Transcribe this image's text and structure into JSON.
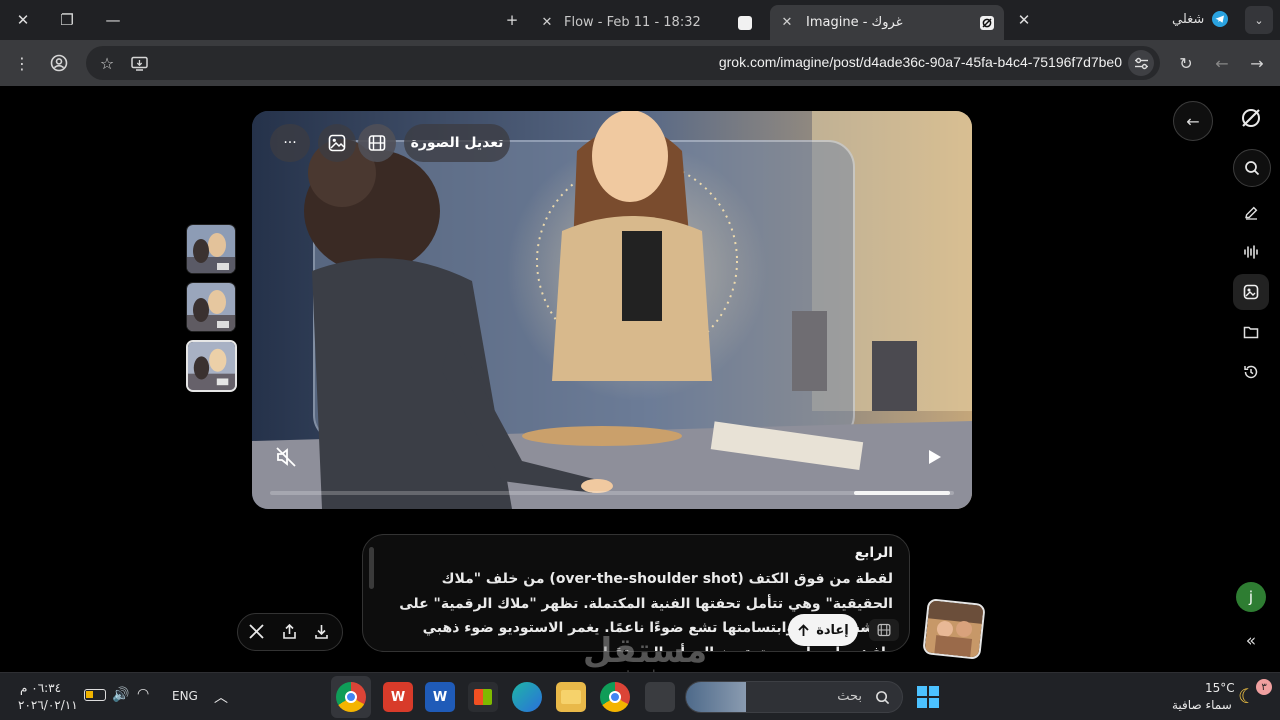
{
  "browser": {
    "tabs": [
      {
        "title": "Flow - Feb 11 - 18:32",
        "active": false
      },
      {
        "title": "Imagine - غروك",
        "active": true
      }
    ],
    "profile_label": "شغلي",
    "url": "grok.com/imagine/post/d4ade36c-90a7-45fa-b4c4-75196f7d7be0"
  },
  "video": {
    "edit_image_label": "تعديل الصورة",
    "more_label": "···",
    "progress": 0.86
  },
  "prompt": {
    "heading": "الرابع",
    "body": "لقطة من فوق الكتف (over-the-shoulder shot) من خلف \"ملاك الحقيقية\" وهي تتأمل تحفتها الفنية المكتملة. تظهر \"ملاك الرقمية\" على شاشة ضخمة، وابتسامتها تشع ضوءًا ناعمًا. يغمر الاستوديو ضوء ذهبي دافئ، ولمسات بريق ترمز إلى أن المستقبل"
  },
  "redo_label": "إعادة",
  "avatar_initial": "j",
  "watermark": {
    "main": "مستقل",
    "sub": "mostaql.com"
  },
  "taskbar": {
    "search_placeholder": "بحث",
    "language": "ENG",
    "time": "٠٦:٣٤ م",
    "date": "٢٠٢٦/٠٢/١١",
    "weather_temp": "15°C",
    "weather_desc": "سماء صافية",
    "notification_count": "٣"
  },
  "colors": {
    "browser_bg": "#202124",
    "toolbar_bg": "#3a3b3e",
    "page_bg": "#000000",
    "taskbar_bg": "#202226",
    "avatar_green": "#2e7d32"
  },
  "icons": [
    "close-icon",
    "restore-icon",
    "minimize-icon",
    "new-tab-icon",
    "telegram-icon",
    "dropdown-icon",
    "menu-dots-icon",
    "profile-icon",
    "star-icon",
    "install-icon",
    "tune-icon",
    "reload-icon",
    "back-icon",
    "forward-icon",
    "grok-logo-icon",
    "search-icon",
    "edit-icon",
    "voice-icon",
    "imagine-icon",
    "folder-icon",
    "history-icon",
    "collapse-icon",
    "image-icon",
    "film-icon",
    "mute-icon",
    "play-icon",
    "x-icon",
    "share-icon",
    "download-icon",
    "arrow-up-icon",
    "chevron-down-icon",
    "windows-icon",
    "chrome-icon",
    "wps-icon",
    "word-icon",
    "store-icon",
    "edge-icon",
    "explorer-icon",
    "wifi-icon",
    "volume-icon",
    "battery-icon",
    "caret-up-icon",
    "moon-icon"
  ]
}
